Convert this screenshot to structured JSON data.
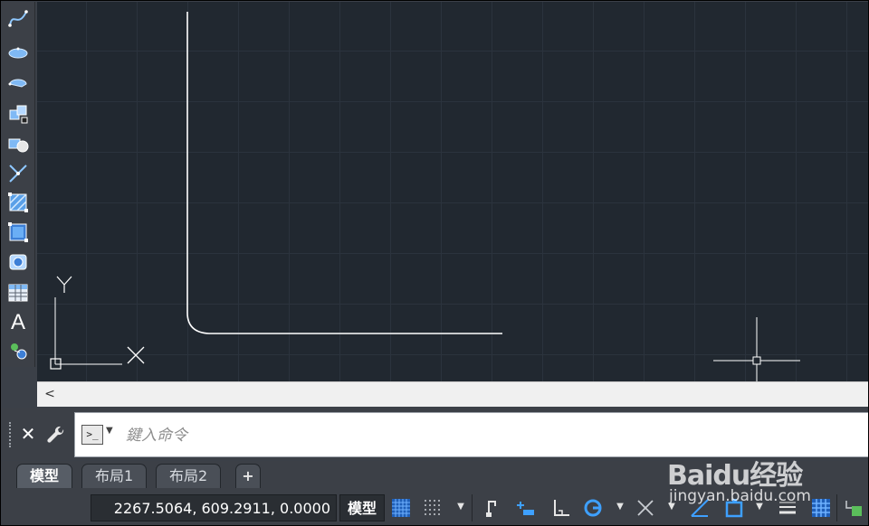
{
  "toolbar": {
    "items": [
      {
        "name": "spline-icon"
      },
      {
        "name": "ellipse-icon"
      },
      {
        "name": "ellipse-arc-icon"
      },
      {
        "name": "insert-block-icon"
      },
      {
        "name": "make-block-icon"
      },
      {
        "name": "point-icon"
      },
      {
        "name": "hatch-icon"
      },
      {
        "name": "gradient-icon"
      },
      {
        "name": "region-icon"
      },
      {
        "name": "table-icon"
      },
      {
        "name": "multiline-text-icon",
        "glyph": "A"
      },
      {
        "name": "add-selected-icon"
      }
    ]
  },
  "canvas": {
    "ucs_y_label": "Y"
  },
  "scrollbar": {
    "left_arrow": "<"
  },
  "command_line": {
    "close_label": "✕",
    "prompt_glyph": ">_",
    "placeholder": "鍵入命令"
  },
  "layout_tabs": {
    "tabs": [
      {
        "label": "模型",
        "active": true
      },
      {
        "label": "布局1",
        "active": false
      },
      {
        "label": "布局2",
        "active": false
      }
    ],
    "add_label": "+"
  },
  "status_bar": {
    "coordinates": "2267.5064, 609.2911, 0.0000",
    "model_space_label": "模型",
    "icons": [
      "grid-icon",
      "snap-icon",
      "infer-constraints-icon",
      "dynamic-input-icon",
      "ortho-icon",
      "polar-tracking-icon",
      "isodraft-icon",
      "object-snap-tracking-icon",
      "object-snap-icon",
      "lineweight-icon",
      "transparency-icon",
      "selection-cycling-icon"
    ]
  },
  "watermark": {
    "logo_text": "Baidu经验",
    "url_text": "jingyan.baidu.com"
  },
  "colors": {
    "canvas_bg": "#212830",
    "grid_line": "#2b333d",
    "ui_panel": "#3c4047",
    "accent_blue": "#2f8fff"
  }
}
